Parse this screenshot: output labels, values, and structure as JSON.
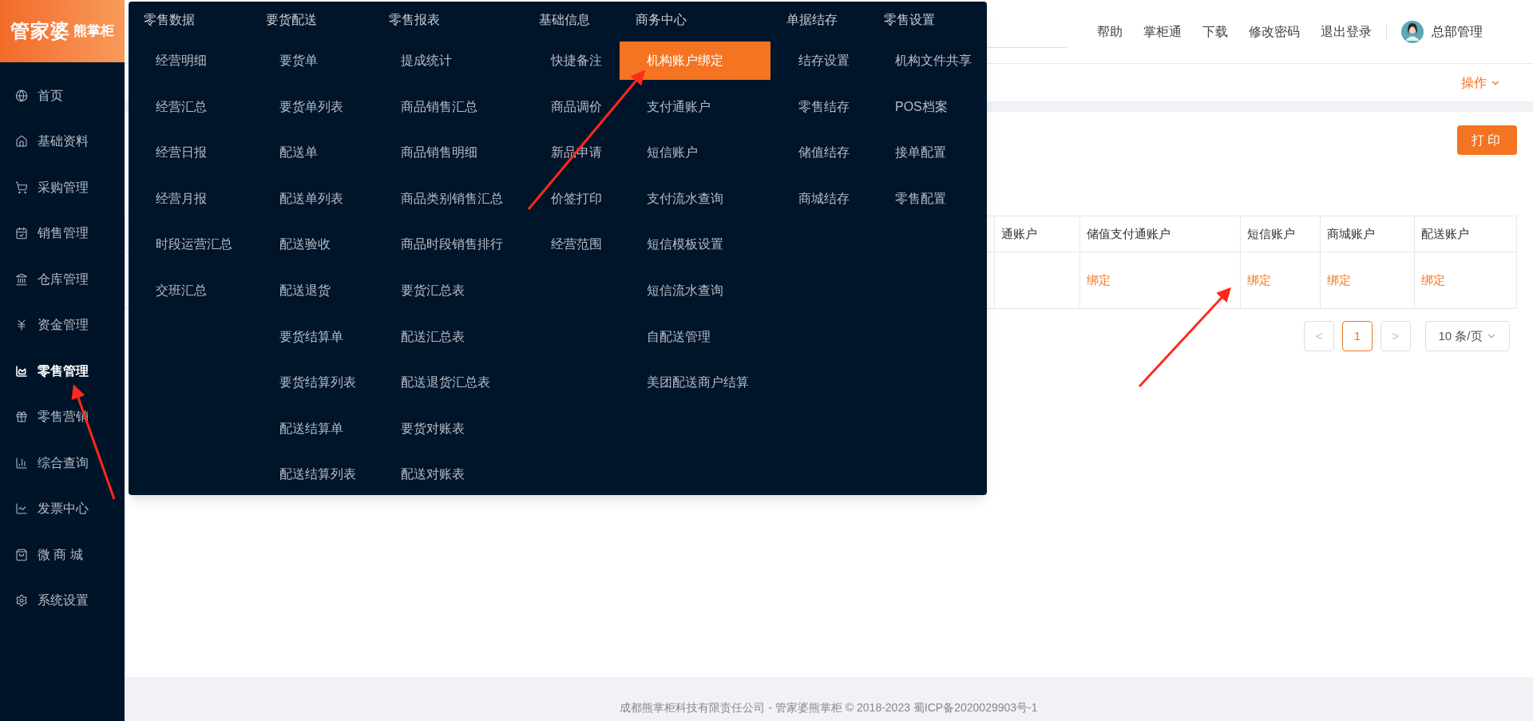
{
  "logo": {
    "brand": "管家婆",
    "product": "熊掌柜"
  },
  "sidebar": {
    "items": [
      {
        "label": "首页",
        "selected": false
      },
      {
        "label": "基础资料",
        "selected": false
      },
      {
        "label": "采购管理",
        "selected": false
      },
      {
        "label": "销售管理",
        "selected": false
      },
      {
        "label": "仓库管理",
        "selected": false
      },
      {
        "label": "资金管理",
        "selected": false
      },
      {
        "label": "零售管理",
        "selected": true
      },
      {
        "label": "零售营销",
        "selected": false
      },
      {
        "label": "综合查询",
        "selected": false
      },
      {
        "label": "发票中心",
        "selected": false
      },
      {
        "label": "微 商 城",
        "selected": false
      },
      {
        "label": "系统设置",
        "selected": false
      }
    ]
  },
  "menu": {
    "columns": [
      {
        "title": "零售数据",
        "items": [
          {
            "label": "经营明细",
            "selected": false
          },
          {
            "label": "经营汇总",
            "selected": false
          },
          {
            "label": "经营日报",
            "selected": false
          },
          {
            "label": "经营月报",
            "selected": false
          },
          {
            "label": "时段运营汇总",
            "selected": false
          },
          {
            "label": "交班汇总",
            "selected": false
          }
        ]
      },
      {
        "title": "要货配送",
        "items": [
          {
            "label": "要货单",
            "selected": false
          },
          {
            "label": "要货单列表",
            "selected": false
          },
          {
            "label": "配送单",
            "selected": false
          },
          {
            "label": "配送单列表",
            "selected": false
          },
          {
            "label": "配送验收",
            "selected": false
          },
          {
            "label": "配送退货",
            "selected": false
          },
          {
            "label": "要货结算单",
            "selected": false
          },
          {
            "label": "要货结算列表",
            "selected": false
          },
          {
            "label": "配送结算单",
            "selected": false
          },
          {
            "label": "配送结算列表",
            "selected": false
          }
        ]
      },
      {
        "title": "零售报表",
        "items": [
          {
            "label": "提成统计",
            "selected": false
          },
          {
            "label": "商品销售汇总",
            "selected": false
          },
          {
            "label": "商品销售明细",
            "selected": false
          },
          {
            "label": "商品类别销售汇总",
            "selected": false
          },
          {
            "label": "商品时段销售排行",
            "selected": false
          },
          {
            "label": "要货汇总表",
            "selected": false
          },
          {
            "label": "配送汇总表",
            "selected": false
          },
          {
            "label": "配送退货汇总表",
            "selected": false
          },
          {
            "label": "要货对账表",
            "selected": false
          },
          {
            "label": "配送对账表",
            "selected": false
          }
        ]
      },
      {
        "title": "基础信息",
        "items": [
          {
            "label": "快捷备注",
            "selected": false
          },
          {
            "label": "商品调价",
            "selected": false
          },
          {
            "label": "新品申请",
            "selected": false
          },
          {
            "label": "价签打印",
            "selected": false
          },
          {
            "label": "经营范围",
            "selected": false
          }
        ]
      },
      {
        "title": "商务中心",
        "items": [
          {
            "label": "机构账户绑定",
            "selected": true
          },
          {
            "label": "支付通账户",
            "selected": false
          },
          {
            "label": "短信账户",
            "selected": false
          },
          {
            "label": "支付流水查询",
            "selected": false
          },
          {
            "label": "短信模板设置",
            "selected": false
          },
          {
            "label": "短信流水查询",
            "selected": false
          },
          {
            "label": "自配送管理",
            "selected": false
          },
          {
            "label": "美团配送商户结算",
            "selected": false
          }
        ]
      },
      {
        "title": "单据结存",
        "items": [
          {
            "label": "结存设置",
            "selected": false
          },
          {
            "label": "零售结存",
            "selected": false
          },
          {
            "label": "储值结存",
            "selected": false
          },
          {
            "label": "商城结存",
            "selected": false
          }
        ]
      },
      {
        "title": "零售设置",
        "items": [
          {
            "label": "机构文件共享",
            "selected": false
          },
          {
            "label": "POS档案",
            "selected": false
          },
          {
            "label": "接单配置",
            "selected": false
          },
          {
            "label": "零售配置",
            "selected": false
          }
        ]
      }
    ]
  },
  "header": {
    "links": [
      "帮助",
      "掌柜通",
      "下载",
      "修改密码",
      "退出登录"
    ],
    "user": "总部管理"
  },
  "toolbar": {
    "action": "操作"
  },
  "print_button": "打印",
  "table": {
    "columns": [
      "通账户",
      "储值支付通账户",
      "短信账户",
      "商城账户",
      "配送账户"
    ],
    "rows": [
      {
        "cells": [
          "",
          "绑定",
          "绑定",
          "绑定",
          "绑定"
        ]
      }
    ]
  },
  "pagination": {
    "prev": "<",
    "pages": [
      {
        "label": "1",
        "selected": true
      }
    ],
    "next": ">",
    "page_size": "10 条/页"
  },
  "footer": "成都熊掌柜科技有限责任公司 - 管家婆熊掌柜 © 2018-2023 蜀ICP备2020029903号-1"
}
